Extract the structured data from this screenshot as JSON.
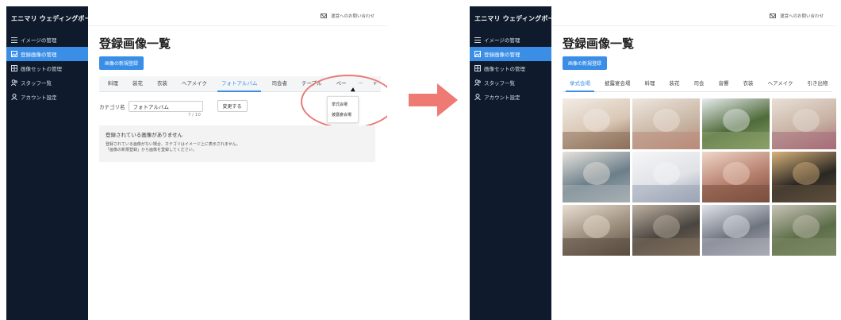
{
  "colors": {
    "sidebar_bg": "#0f1b2c",
    "accent": "#3a8ee6",
    "highlight": "#e77c77",
    "arrow": "#ef7a73"
  },
  "sidebar": {
    "logo": "エニマリ ウェディングボード",
    "items": [
      {
        "label": "イメージの管理",
        "icon": "list-icon",
        "active": false
      },
      {
        "label": "登録画像の管理",
        "icon": "image-icon",
        "active": true
      },
      {
        "label": "画像セットの管理",
        "icon": "grid-icon",
        "active": false
      },
      {
        "label": "スタッフ一覧",
        "icon": "users-icon",
        "active": false
      },
      {
        "label": "アカウント設定",
        "icon": "user-icon",
        "active": false
      }
    ]
  },
  "header": {
    "contact_link": "運営へのお問い合わせ"
  },
  "left": {
    "page_title": "登録画像一覧",
    "new_button": "画像の新規登録",
    "tabs": [
      "料理",
      "装花",
      "衣装",
      "ヘアメイク",
      "フォトアルバム",
      "司会者",
      "テーブル",
      "ペー"
    ],
    "active_tab": "フォトアルバム",
    "more_label": "···",
    "plus_label": "+",
    "dropdown_options": [
      "挙式会場",
      "披露宴会場"
    ],
    "category_label": "カテゴリ名",
    "category_value": "フォトアルバム",
    "change_button": "変更する",
    "counter": "7 / 10",
    "empty_title": "登録されている画像がありません",
    "empty_line1": "登録されている画像がない場合、カテゴリはイメージ上に表示されません。",
    "empty_line2": "「画像の新規登録」から画像を登録してください。"
  },
  "right": {
    "page_title": "登録画像一覧",
    "new_button": "画像の新規登録",
    "tabs": [
      "挙式会場",
      "披露宴会場",
      "料理",
      "装花",
      "司会",
      "音響",
      "衣装",
      "ヘアメイク",
      "引き出物",
      "ペ"
    ],
    "active_tab": "挙式会場",
    "more_label": "···",
    "photos": [
      {
        "name": "photo-rings",
        "colors": [
          "#d9c7b4",
          "#f2ece6",
          "#8c6f5a"
        ]
      },
      {
        "name": "photo-bouquet",
        "colors": [
          "#c9b8a6",
          "#efe6de",
          "#b98b7a"
        ]
      },
      {
        "name": "photo-garden-gazebo",
        "colors": [
          "#4f6b3a",
          "#e8ecef",
          "#8aa06a"
        ]
      },
      {
        "name": "photo-floral-arch",
        "colors": [
          "#c7b1a3",
          "#e9e0d6",
          "#a66b78"
        ]
      },
      {
        "name": "photo-banquet-hall",
        "colors": [
          "#6b7f8a",
          "#e8e3dc",
          "#a6aeb2"
        ]
      },
      {
        "name": "photo-white-hall",
        "colors": [
          "#e0e2e6",
          "#f6f6f8",
          "#9aa4b5"
        ]
      },
      {
        "name": "photo-pink-hall",
        "colors": [
          "#b67f6d",
          "#f0d6c8",
          "#7a4e3e"
        ]
      },
      {
        "name": "photo-dark-ballroom",
        "colors": [
          "#2a2723",
          "#d8b27a",
          "#5e4f3c"
        ]
      },
      {
        "name": "photo-grand-staircase",
        "colors": [
          "#9a8b7a",
          "#e8dfd2",
          "#5a4c40"
        ]
      },
      {
        "name": "photo-theater-hall",
        "colors": [
          "#4a4540",
          "#bfb2a2",
          "#7e6e5c"
        ]
      },
      {
        "name": "photo-crystal-hall",
        "colors": [
          "#6f7580",
          "#e2e4ea",
          "#a9acb5"
        ]
      },
      {
        "name": "photo-manor-house",
        "colors": [
          "#5c6d48",
          "#c9c4b8",
          "#7e8a66"
        ]
      }
    ]
  }
}
